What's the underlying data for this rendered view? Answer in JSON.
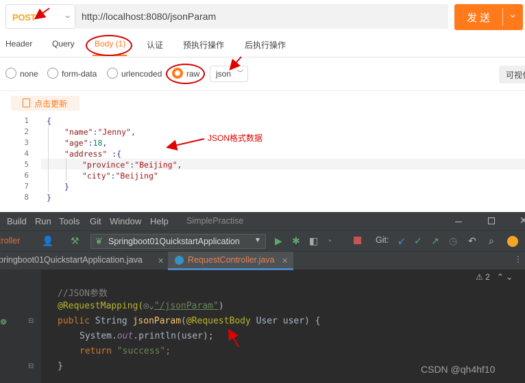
{
  "request": {
    "method": "POST",
    "url": "http://localhost:8080/jsonParam",
    "send_label": "发送"
  },
  "tabs": [
    "Header",
    "Query",
    "Body (1)",
    "认证",
    "预执行操作",
    "后执行操作"
  ],
  "body_types": [
    "none",
    "form-data",
    "urlencoded",
    "raw"
  ],
  "selected_body_type": "raw",
  "format": "json",
  "visual_label": "可视化",
  "update_label": "点击更新",
  "json_lines": [
    {
      "n": "1",
      "text": "{"
    },
    {
      "n": "2",
      "key": "\"name\"",
      "sep": ":",
      "val": "\"Jenny\"",
      "end": ","
    },
    {
      "n": "3",
      "key": "\"age\"",
      "sep": ":",
      "num": "18",
      "end": ","
    },
    {
      "n": "4",
      "key": "\"address\"",
      "sep": " :{"
    },
    {
      "n": "5",
      "key": "\"province\"",
      "sep": ":",
      "val": "\"Beijing\"",
      "end": ","
    },
    {
      "n": "6",
      "key": "\"city\"",
      "sep": ":",
      "val": "\"Beijing\""
    },
    {
      "n": "7",
      "text": "}"
    },
    {
      "n": "8",
      "text": "}"
    }
  ],
  "annotation": "JSON格式数据",
  "ide": {
    "menu": [
      "Build",
      "Run",
      "Tools",
      "Git",
      "Window",
      "Help"
    ],
    "project": "SimplePractise",
    "controller_crumb": "troller",
    "run_config": "Springboot01QuickstartApplication",
    "git_label": "Git:",
    "file_tab_1": "pringboot01QuickstartApplication.java",
    "file_tab_2": "RequestController.java",
    "warnings": "2",
    "code": {
      "comment": "//JSON参数",
      "mapping_annotation": "@RequestMapping(",
      "mapping_path": "\"/jsonParam\"",
      "mapping_close": ")",
      "kw_public": "public",
      "type_string": " String ",
      "method_name": "jsonParam",
      "paren_open": "(",
      "req_body": "@RequestBody",
      "params": " User user) {",
      "sys": "System.",
      "out": "out",
      "println": ".println(user);",
      "kw_return": "return",
      "ret_val": "\"success\"",
      "semicolon": ";",
      "close": "}"
    }
  },
  "watermark": "CSDN @qh4hf10"
}
